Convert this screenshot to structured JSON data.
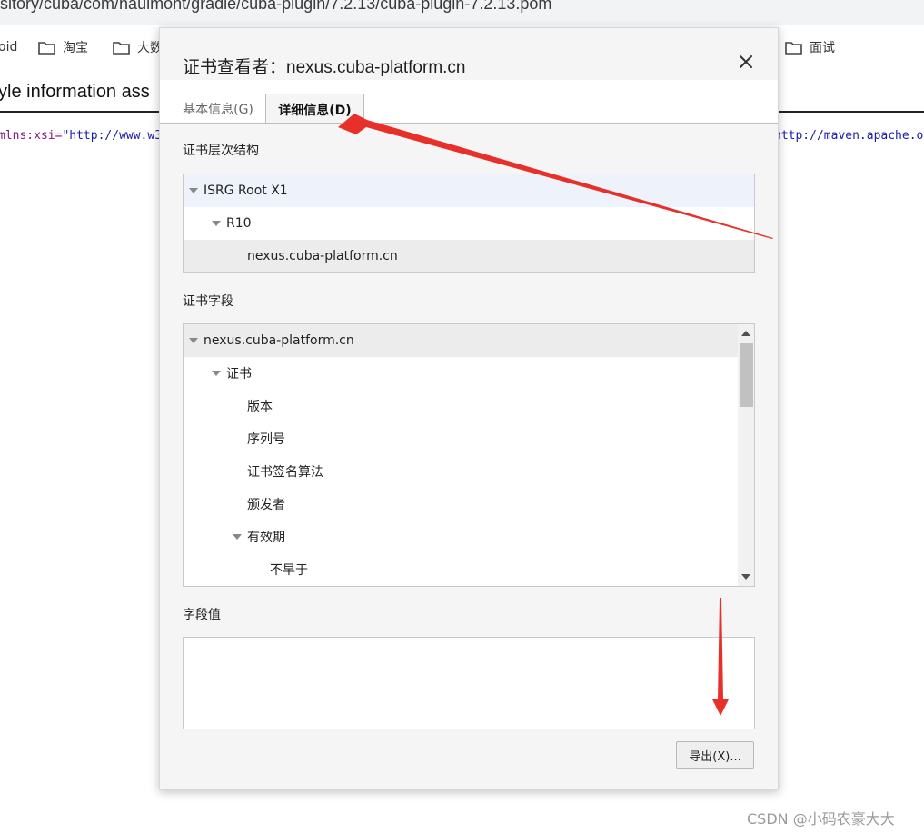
{
  "browser": {
    "url": "sitory/cuba/com/haulmont/gradle/cuba-plugin/7.2.13/cuba-plugin-7.2.13.pom",
    "bookmarks": [
      {
        "label": "oid"
      },
      {
        "label": "淘宝"
      },
      {
        "label": "大数"
      },
      {
        "label": "面试"
      }
    ]
  },
  "page": {
    "heading": "yle information ass",
    "xml_left_attr": "mlns:xsi=",
    "xml_left_value": "\"http://www.w3",
    "xml_right": "http://maven.apache.o"
  },
  "dialog": {
    "title": "证书查看者：nexus.cuba-platform.cn",
    "tabs": [
      {
        "label": "基本信息(G)",
        "active": false
      },
      {
        "label": "详细信息(D)",
        "active": true
      }
    ],
    "hierarchy_label": "证书层次结构",
    "hierarchy": [
      {
        "label": "ISRG Root X1",
        "level": 0,
        "expanded": true,
        "selected": true
      },
      {
        "label": "R10",
        "level": 1,
        "expanded": true,
        "selected": false
      },
      {
        "label": "nexus.cuba-platform.cn",
        "level": 2,
        "expanded": false,
        "selected": false
      }
    ],
    "fields_label": "证书字段",
    "fields": [
      {
        "label": "nexus.cuba-platform.cn",
        "level": 0,
        "expanded": true
      },
      {
        "label": "证书",
        "level": 1,
        "expanded": true
      },
      {
        "label": "版本",
        "level": 2,
        "expanded": false
      },
      {
        "label": "序列号",
        "level": 2,
        "expanded": false
      },
      {
        "label": "证书签名算法",
        "level": 2,
        "expanded": false
      },
      {
        "label": "颁发者",
        "level": 2,
        "expanded": false
      },
      {
        "label": "有效期",
        "level": 2,
        "expanded": true
      },
      {
        "label": "不早于",
        "level": 3,
        "expanded": false
      }
    ],
    "value_label": "字段值",
    "field_value": "",
    "export_label": "导出(X)..."
  },
  "colors": {
    "arrow": "#e8302a",
    "dialog_bg": "#f5f5f5",
    "selected_row": "#eef3fb",
    "highlight_row": "#ececec"
  },
  "watermark": "CSDN @小码农豪大大"
}
